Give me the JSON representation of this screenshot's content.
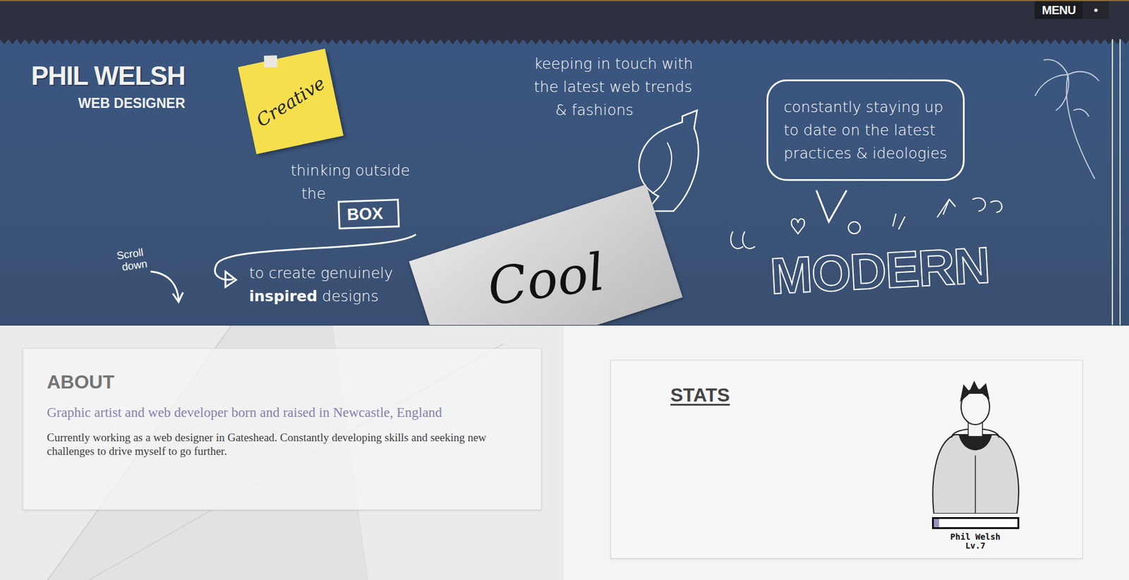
{
  "menu": {
    "label": "MENU",
    "icon": "●"
  },
  "header": {
    "name": "PHIL WELSH",
    "role": "WEB DESIGNER"
  },
  "hero": {
    "sticky_note": "Creative",
    "thinking": [
      "thinking outside",
      "the"
    ],
    "box": "BOX",
    "create": "to create genuinely",
    "inspired": "inspired",
    "designs": "designs",
    "scroll": [
      "Scroll",
      "down"
    ],
    "trends": [
      "keeping in touch with",
      "the latest web trends",
      "& fashions"
    ],
    "bubble": [
      "constantly staying up",
      "to date on the latest",
      "practices & ideologies"
    ],
    "paper": "Cool",
    "modern": "MODERN"
  },
  "about": {
    "title": "ABOUT",
    "subtitle": "Graphic artist and web developer born and raised in Newcastle, England",
    "body": "Currently working as a web designer in Gateshead. Constantly developing skills and seeking new challenges to drive myself to go further."
  },
  "stats": {
    "title": "STATS",
    "player": {
      "name": "Phil Welsh",
      "level_text": "Lv.7",
      "level": 0.07
    }
  }
}
